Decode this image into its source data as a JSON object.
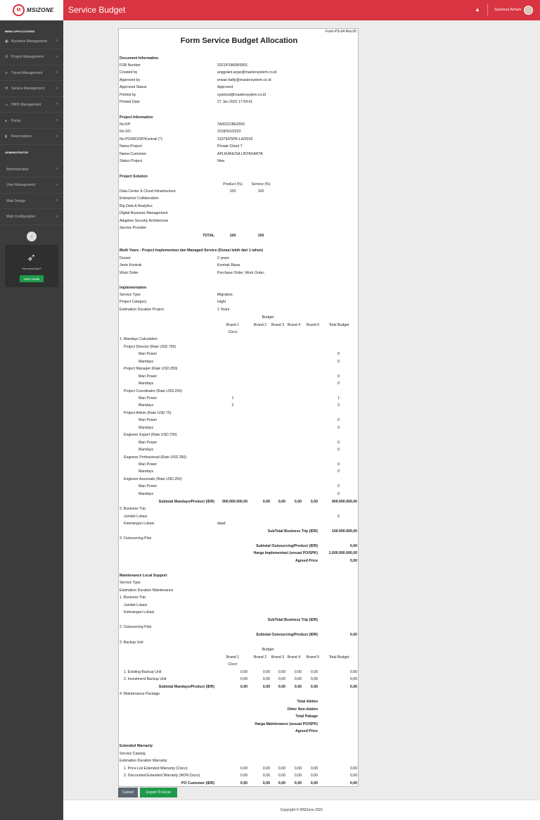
{
  "header": {
    "title": "Service Budget",
    "user": "Syamsul Arham",
    "brand": "MSIZONE"
  },
  "sidebar": {
    "menu_title": "MENU APPLICATIONS",
    "items": [
      {
        "label": "Business Management",
        "icon": "briefcase-icon"
      },
      {
        "label": "Project Management",
        "icon": "list-icon"
      },
      {
        "label": "Travel Management",
        "icon": "plane-icon"
      },
      {
        "label": "Service Management",
        "icon": "wrench-icon"
      },
      {
        "label": "HRIS Management",
        "icon": "users-icon"
      },
      {
        "label": "Portal",
        "icon": "globe-icon"
      },
      {
        "label": "Reservations",
        "icon": "bookmark-icon"
      }
    ],
    "admin_title": "ADMINISTRATOR",
    "admin_items": [
      {
        "label": "Administration"
      },
      {
        "label": "User Management"
      },
      {
        "label": "Web Design"
      },
      {
        "label": "Web Configuration"
      }
    ],
    "help_text": "You need help?",
    "guide_label": "User Guide"
  },
  "form": {
    "code": "Form-PS-04 Rev.06",
    "title": "Form Service Budget Allocation",
    "doc_header": "Document Information",
    "doc": [
      {
        "label": "FSB Number",
        "value": "2021/FSB/08/0001"
      },
      {
        "label": "Created by",
        "value": "anggrainl.anjar@mastersystem.co.id"
      },
      {
        "label": "Approved by",
        "value": "erwan.fadly@mastersystem.co.id"
      },
      {
        "label": "Approved Status",
        "value": "Approved"
      },
      {
        "label": "Printed by",
        "value": "syamsul@mastersystem.co.id"
      },
      {
        "label": "Printed Date",
        "value": "27 Jan 2022 17:54:41"
      }
    ],
    "proj_header": "Project Information",
    "proj": [
      {
        "label": "No.KP:",
        "value": "TA00221BE0092"
      },
      {
        "label": "No.SO:",
        "value": "2018/SO/2923"
      },
      {
        "label": "No PO/WO/SP/Kontrak (*):",
        "value": "31979/I/SPK-LA/2018"
      },
      {
        "label": "Nama Project:",
        "value": "Private Cloud 7"
      },
      {
        "label": "Nama Customer:",
        "value": "APLIKANUSA LINTASARTA"
      },
      {
        "label": "Status Project",
        "value": "New"
      }
    ],
    "sol_header": "Project Solution",
    "sol_col_product": "Product (%)",
    "sol_col_service": "Service (%)",
    "solutions": [
      {
        "name": "Data Center & Cloud Infrastructure",
        "product": "100",
        "service": "100"
      },
      {
        "name": "Enterprise Collaboration",
        "product": "",
        "service": ""
      },
      {
        "name": "Big Data & Analytics",
        "product": "",
        "service": ""
      },
      {
        "name": "Digital Business Management",
        "product": "",
        "service": ""
      },
      {
        "name": "Adaptive Security Architecture",
        "product": "",
        "service": ""
      },
      {
        "name": "Service Provider",
        "product": "",
        "service": ""
      }
    ],
    "sol_total_label": "TOTAL",
    "sol_total_product": "100",
    "sol_total_service": "100",
    "multi_header": "Multi Years - Project Implementasi dan Managed Service (Durasi lebih dari 1 tahun)",
    "multi": [
      {
        "label": "Durasi:",
        "value": "2 years"
      },
      {
        "label": "Jenis Kontrak",
        "value": "Kontrak Biasa"
      },
      {
        "label": "Work Order",
        "value": "Purchase Order; Work Order;"
      }
    ],
    "impl_header": "Implementation",
    "impl": [
      {
        "label": "Service Type",
        "value": "Migration;"
      },
      {
        "label": "Project Category",
        "value": "Hight"
      },
      {
        "label": "Estimation Duration Project",
        "value": "1 Years"
      }
    ],
    "budget_label": "Budget",
    "brand_cols": [
      "Brand 1",
      "Brand 2",
      "Brand 3",
      "Brand 4",
      "Brand 5",
      "Total Budget"
    ],
    "brand1_name": "Cisco",
    "mandays_title": "1. Mandays Calculation",
    "roles": [
      {
        "role": "Project Director (Rate USD.700)",
        "mp_b1": "",
        "mp_total": "0",
        "md_b1": "",
        "md_total": "0"
      },
      {
        "role": "Project Manager (Rate USD.350)",
        "mp_b1": "",
        "mp_total": "0",
        "md_b1": "",
        "md_total": "0"
      },
      {
        "role": "Project Coordinator (Rate USD.250)",
        "mp_b1": "1",
        "mp_total": "1",
        "md_b1": "2",
        "md_total": "2"
      },
      {
        "role": "Project Admin (Rate USD.75)",
        "mp_b1": "",
        "mp_total": "0",
        "md_b1": "",
        "md_total": "0"
      },
      {
        "role": "Engineer Expert (Rate USD.700)",
        "mp_b1": "",
        "mp_total": "0",
        "md_b1": "",
        "md_total": "0"
      },
      {
        "role": "Engineer Professional (Rate USD.350)",
        "mp_b1": "",
        "mp_total": "0",
        "md_b1": "",
        "md_total": "0"
      },
      {
        "role": "Engineer Associate (Rate USD.250)",
        "mp_b1": "",
        "mp_total": "0",
        "md_b1": "",
        "md_total": "0"
      }
    ],
    "man_power": "Man Power",
    "mandays": "Mandays",
    "subtotal_mandays_label": "Subtotal Mandays/Product (IDR)",
    "subtotal_mandays": [
      "900.000.000,00",
      "0,00",
      "0,00",
      "0,00",
      "0,00",
      "900.000.000,00"
    ],
    "business_trip": "2. Business Trip",
    "jumlah_lokasi": "Jumlah Lokasi",
    "jumlah_lokasi_value": "5",
    "ket_lokasi": "Keterangan Lokasi",
    "ket_lokasi_value": "daad",
    "subtotal_bt_label": "SubTotal Business Trip (IDR)",
    "subtotal_bt_value": "100.000.000,00",
    "outsourcing": "3. Outsourcing Plan",
    "subtotal_out_label": "Subtotal Outsourcing/Product (IDR)",
    "subtotal_out_value": "0,00",
    "harga_impl_label": "Harga Implementasi (sesuai PO/SPK)",
    "harga_impl_value": "1.000.000.000,00",
    "agreed_label": "Agreed Price",
    "agreed_value": "0,00",
    "mls_header": "Maintenance Local Support",
    "mls_service_type": "Service Type",
    "mls_duration": "Estimation Duration Maintenance",
    "mls_bt": "1. Business Trip",
    "mls_jumlah": "Jumlah Lokasi",
    "mls_ket": "Keterangan Lokasi",
    "mls_subtotal_bt": "SubTotal Business Trip (IDR)",
    "mls_outsourcing": "2. Outsourcing Plan",
    "mls_subtotal_out": "Subtotal Outsourcing/Product (IDR)",
    "mls_subtotal_out_value": "0,00",
    "backup_unit": "3. Backup Unit",
    "backup_rows": [
      {
        "label": "1. Existing Backup Unit",
        "values": [
          "0,00",
          "0,00",
          "0,00",
          "0,00",
          "0,00",
          "0,00"
        ]
      },
      {
        "label": "2. Investment Backup Unit",
        "values": [
          "0,00",
          "0,00",
          "0,00",
          "0,00",
          "0,00",
          "0,00"
        ]
      }
    ],
    "backup_subtotal_label": "Subtotal Mandays/Product (IDR)",
    "backup_subtotal": [
      "0,00",
      "0,00",
      "0,00",
      "0,00",
      "0,00",
      "0,00"
    ],
    "maint_package": "4. Maintenance Package",
    "maint_labels": [
      "Total Addon",
      "Other Non-Addon",
      "Total Pakage",
      "Harga Maintenance (sesuai PO/SPK)",
      "Agreed Price"
    ],
    "ew_header": "Extended Warranty",
    "ew_catalog": "Service Catalog",
    "ew_duration": "Estimation Duration Warranty",
    "ew_rows": [
      {
        "label": "1. Price List Extended Warranty (Cisco)",
        "values": [
          "0,00",
          "0,00",
          "0,00",
          "0,00",
          "0,00",
          "0,00"
        ]
      },
      {
        "label": "2. Discounted Extended Warranty (NON Cisco)",
        "values": [
          "0,00",
          "0,00",
          "0,00",
          "0,00",
          "0,00",
          "0,00"
        ]
      }
    ],
    "ew_total_label": "PO Customer (IDR)",
    "ew_total": [
      "0,00",
      "0,00",
      "0,00",
      "0,00",
      "0,00",
      "0,00"
    ]
  },
  "actions": {
    "cancel": "Cancel",
    "export": "Export To Excel"
  },
  "footer": {
    "copyright": "Copyright © MSIZone 2021"
  }
}
